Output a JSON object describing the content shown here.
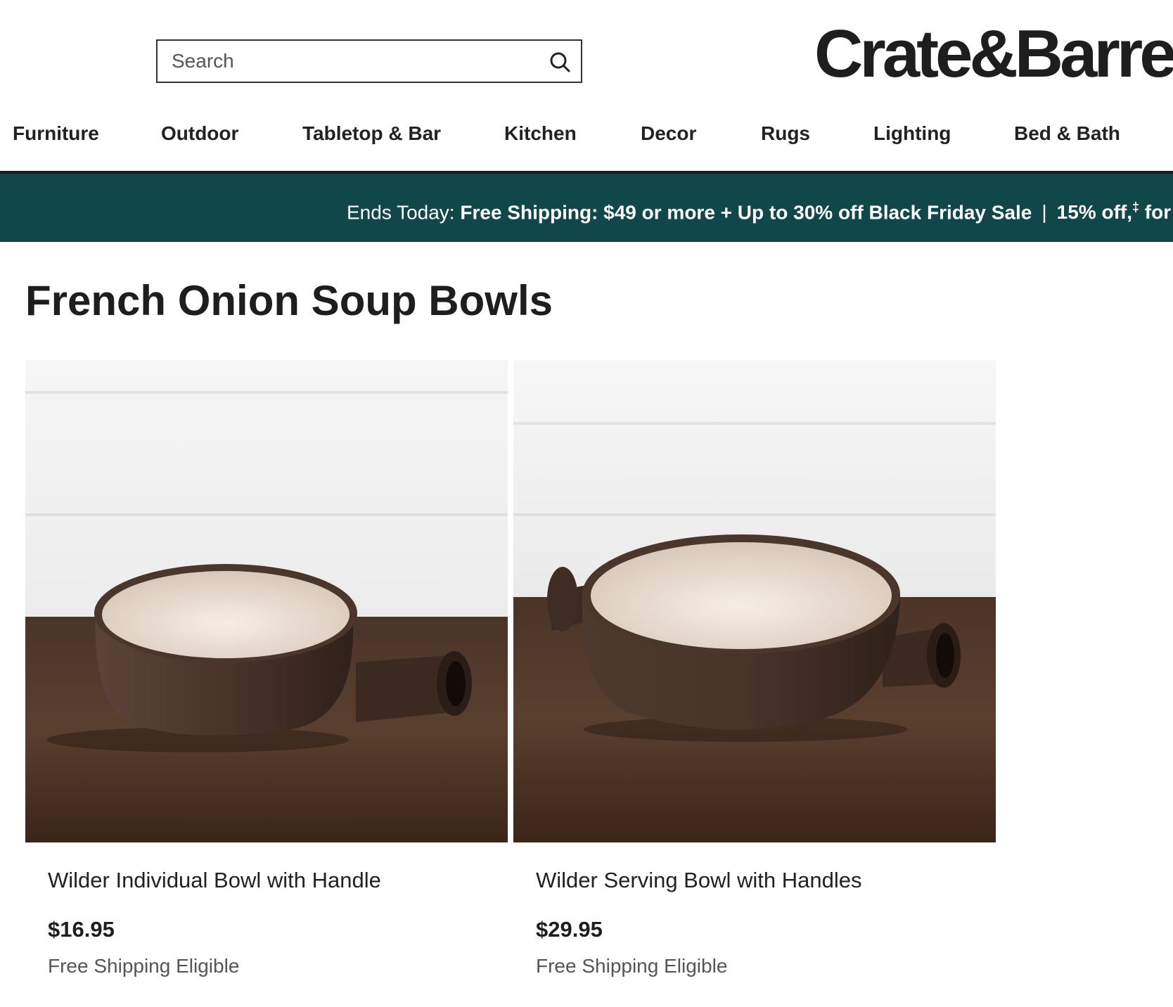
{
  "header": {
    "search": {
      "placeholder": "Search",
      "icon": "search-icon"
    },
    "logo_text": "Crate&Barre"
  },
  "nav": {
    "items": [
      {
        "label": "Furniture"
      },
      {
        "label": "Outdoor"
      },
      {
        "label": "Tabletop & Bar"
      },
      {
        "label": "Kitchen"
      },
      {
        "label": "Decor"
      },
      {
        "label": "Rugs"
      },
      {
        "label": "Lighting"
      },
      {
        "label": "Bed & Bath"
      }
    ]
  },
  "promo": {
    "lead": "Ends Today: ",
    "offer": "Free Shipping: $49 or more + Up to 30% off Black Friday Sale",
    "separator": "|",
    "offer2": "15% off,",
    "dagger": "‡",
    "offer2_tail": " for",
    "background": "#12474a"
  },
  "page_title": "French Onion Soup Bowls",
  "products": [
    {
      "name": "Wilder Individual Bowl with Handle",
      "price": "$16.95",
      "shipping": "Free Shipping Eligible"
    },
    {
      "name": "Wilder Serving Bowl with Handles",
      "price": "$29.95",
      "shipping": "Free Shipping Eligible"
    }
  ]
}
